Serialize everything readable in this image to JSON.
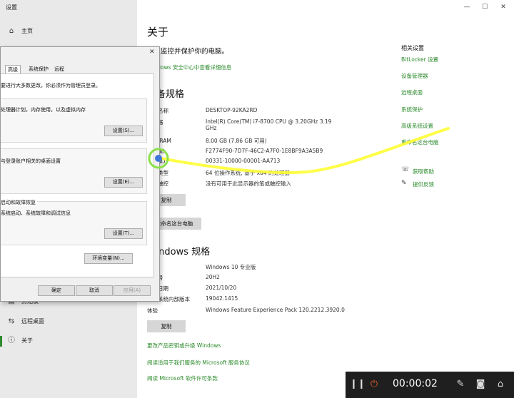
{
  "window": {
    "title": "设置",
    "minimize_icon": "—",
    "maximize_icon": "☐",
    "close_icon": "✕"
  },
  "nav": {
    "home": "主页",
    "items": [
      {
        "label": "剪贴板",
        "icon": "clipboard-icon"
      },
      {
        "label": "远程桌面",
        "icon": "remote-desktop-icon"
      },
      {
        "label": "关于",
        "icon": "info-icon"
      }
    ],
    "clipboard_partial": "剪贴板"
  },
  "main": {
    "title": "关于",
    "protect_text": "正在监控并保护你的电脑。",
    "security_link": "Windows 安全中心中查看详细信息",
    "device_spec_title": "设备规格",
    "device_specs": [
      {
        "label": "设备名称",
        "value": "DESKTOP-92KA2RD"
      },
      {
        "label": "处理器",
        "value": "Intel(R) Core(TM) i7-8700 CPU @ 3.20GHz   3.19 GHz"
      },
      {
        "label": "机带 RAM",
        "value": "8.00 GB (7.86 GB 可用)"
      },
      {
        "label": "设备 ID",
        "value": "F2774F90-7D7F-46C2-A7F0-1E8BF9A3A5B9"
      },
      {
        "label": "产品 ID",
        "value": "00331-10000-00001-AA713"
      },
      {
        "label": "系统类型",
        "value": "64 位操作系统, 基于 x64 的处理器"
      },
      {
        "label": "笔和触控",
        "value": "没有可用于此显示器的笔或触控输入"
      }
    ],
    "copy_button": "复制",
    "rename_button": "重命名这台电脑",
    "win_spec_title": "Windows 规格",
    "win_specs": [
      {
        "label": "版本",
        "value": "Windows 10 专业版"
      },
      {
        "label": "版本号",
        "value": "20H2"
      },
      {
        "label": "安装日期",
        "value": "2021/10/20"
      },
      {
        "label": "操作系统内部版本",
        "value": "19042.1415"
      },
      {
        "label": "体验",
        "value": "Windows Feature Experience Pack 120.2212.3920.0"
      }
    ],
    "copy_button2": "复制",
    "bottom_links": [
      "更改产品密钥或升级 Windows",
      "阅读适用于我们服务的 Microsoft 服务协议",
      "阅读 Microsoft 软件许可条款"
    ]
  },
  "related": {
    "title": "相关设置",
    "links": [
      "BitLocker 设置",
      "设备管理器",
      "远程桌面",
      "系统保护",
      "高级系统设置",
      "重命名这台电脑"
    ],
    "help": "获取帮助",
    "feedback": "提供反馈"
  },
  "dialog": {
    "tabs": [
      "高级",
      "系统保护",
      "远程"
    ],
    "admin_note": "要进行大多数更改，你必须作为管理员登录。",
    "performance_text": "处理器计划，内存使用，以及虚拟内存",
    "performance_button": "设置(S)...",
    "profile_text": "与登录账户相关的桌面设置",
    "profile_button": "设置(E)...",
    "startup_title": "启动和故障恢复",
    "startup_text": "系统启动、系统故障和调试信息",
    "startup_button": "设置(T)...",
    "env_button": "环境变量(N)...",
    "ok_button": "确定",
    "cancel_button": "取消",
    "apply_button": "应用(A)",
    "close_icon": "✕"
  },
  "recorder": {
    "time": "00:00:02"
  },
  "colors": {
    "link": "#2a8a2a",
    "annotation": "#ffff33",
    "cursor_ring": "#8be04a"
  }
}
